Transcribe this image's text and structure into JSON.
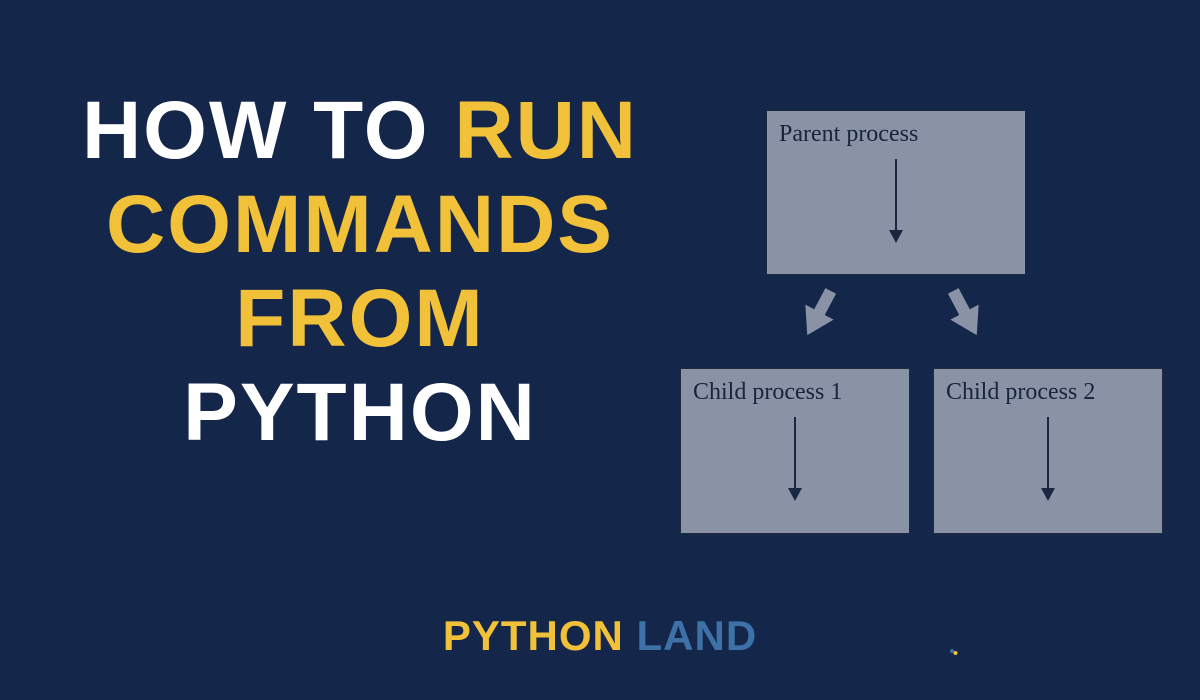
{
  "colors": {
    "background": "#142649",
    "white": "#ffffff",
    "yellow": "#f2c13a",
    "brand_blue": "#3d71a7",
    "box_fill": "#8a93a6",
    "box_text": "#18243d"
  },
  "headline": {
    "w1": "HOW",
    "w2": "TO",
    "w3": "RUN",
    "w4": "COMMANDS",
    "w5": "FROM",
    "w6": "PYTHON"
  },
  "diagram": {
    "parent_label": "Parent process",
    "child1_label": "Child process 1",
    "child2_label": "Child process 2"
  },
  "brand": {
    "word1": "PYTHON",
    "word2": "LAND"
  }
}
